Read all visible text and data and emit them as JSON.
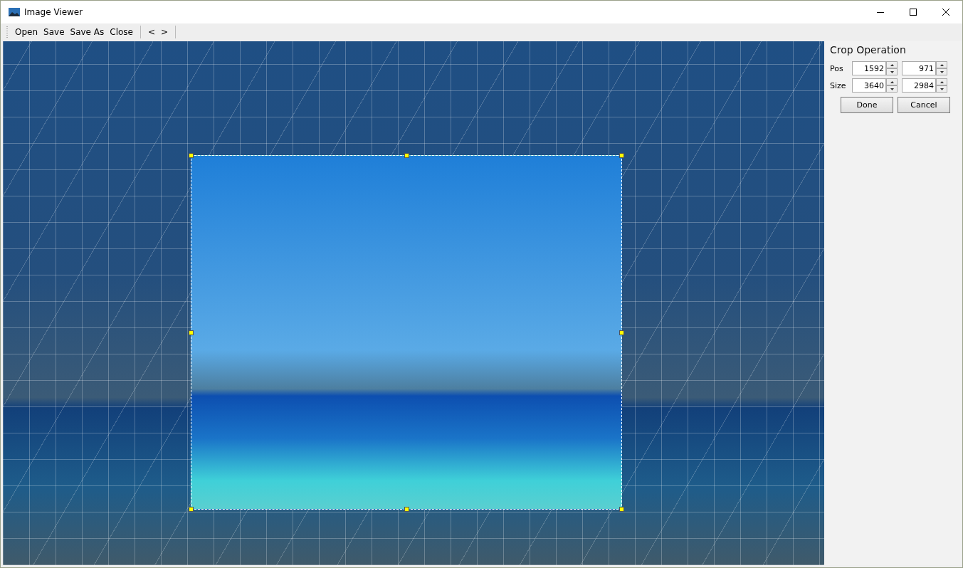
{
  "window": {
    "title": "Image Viewer"
  },
  "toolbar": {
    "groups": [
      [
        "Open",
        "Save",
        "Save As",
        "Close"
      ],
      [
        "<",
        ">"
      ]
    ]
  },
  "crop_panel": {
    "title": "Crop Operation",
    "rows": [
      {
        "label": "Pos",
        "values": [
          "1592",
          "971"
        ]
      },
      {
        "label": "Size",
        "values": [
          "3640",
          "2984"
        ]
      }
    ],
    "buttons": [
      "Done",
      "Cancel"
    ]
  }
}
